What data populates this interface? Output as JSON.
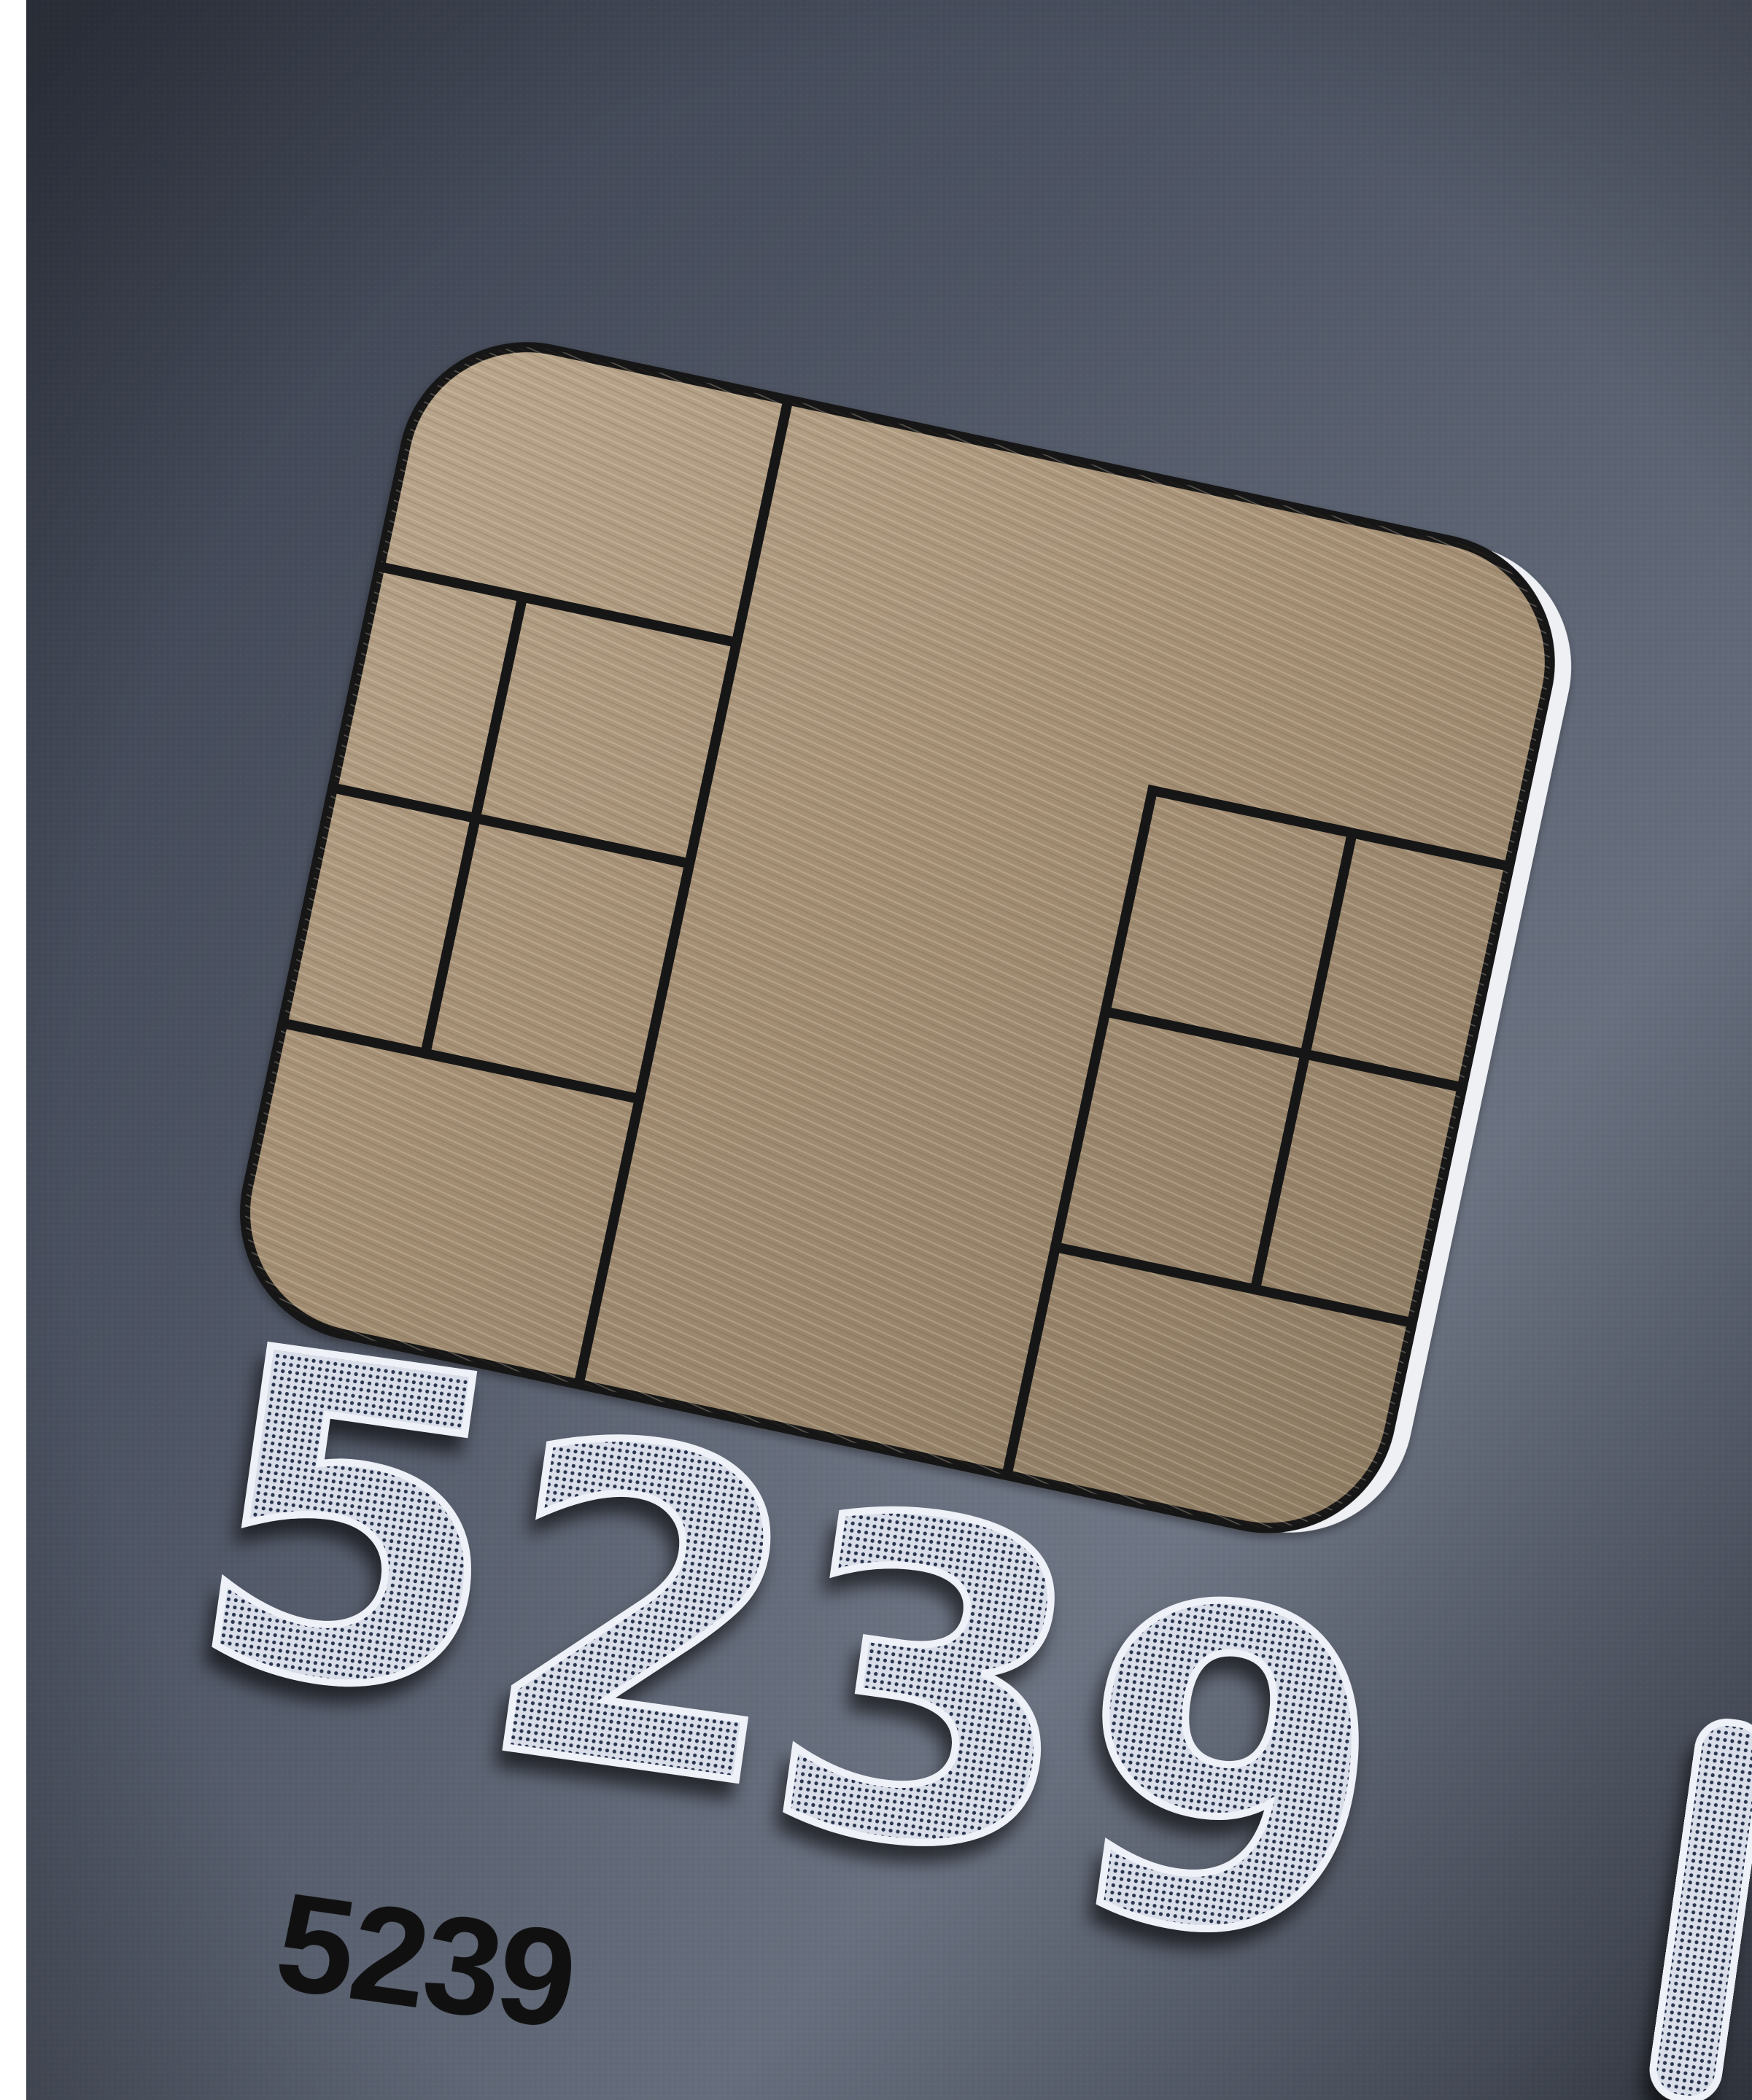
{
  "card": {
    "embossed_number": [
      "5",
      "2",
      "3",
      "9"
    ],
    "printed_number": "5239",
    "colors": {
      "card_surface": "#58606f",
      "chip_gold": "#a89479",
      "chip_line": "#141414",
      "emboss_silver": "#c9cfdc",
      "printed_ink": "#101010"
    }
  },
  "chip": {
    "icon": "emv-chip-contacts"
  }
}
